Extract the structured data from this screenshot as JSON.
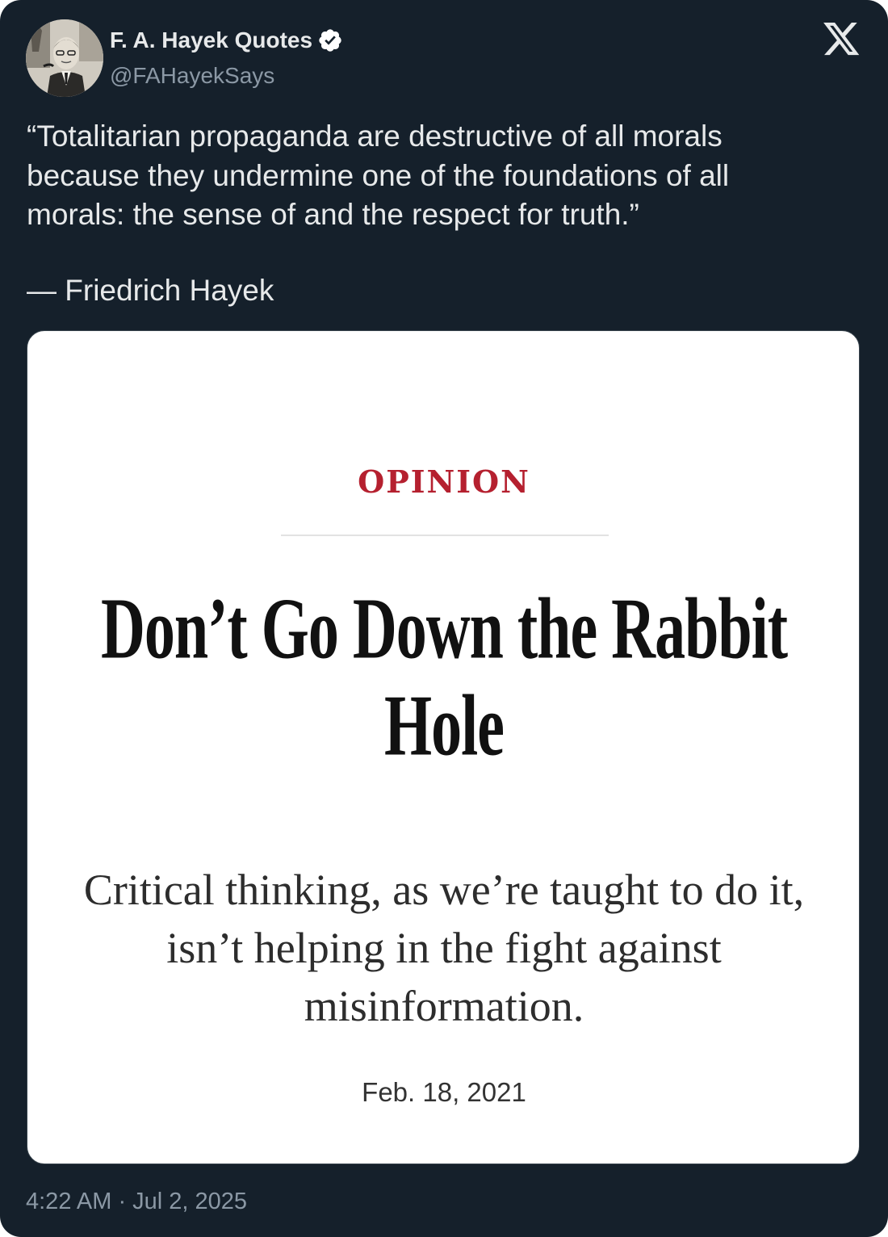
{
  "author": {
    "name": "F. A. Hayek Quotes",
    "handle": "@FAHayekSays",
    "verified": true,
    "avatar_icon": "portrait-avatar",
    "verified_icon": "verified-badge-icon"
  },
  "platform": {
    "logo_icon": "x-logo-icon"
  },
  "tweet": {
    "text_lines": [
      "“Totalitarian propaganda are destructive of all morals",
      "because they undermine one of the foundations of all",
      "morals: the sense of and the respect for truth.”"
    ],
    "attribution": "— Friedrich Hayek",
    "timestamp": "4:22 AM · Jul 2, 2025"
  },
  "media": {
    "section_label": "OPINION",
    "headline_lines": [
      "Don’t Go Down the Rabbit",
      "Hole"
    ],
    "subheadline_lines": [
      "Critical thinking, as we’re taught to do it,",
      "isn’t helping in the fight against",
      "misinformation."
    ],
    "date": "Feb. 18, 2021"
  },
  "colors": {
    "background": "#15202b",
    "text": "#e7e9ea",
    "secondary_text": "#8b98a5",
    "verified_blue": "#1d9bf0",
    "opinion_red": "#b5202f"
  }
}
